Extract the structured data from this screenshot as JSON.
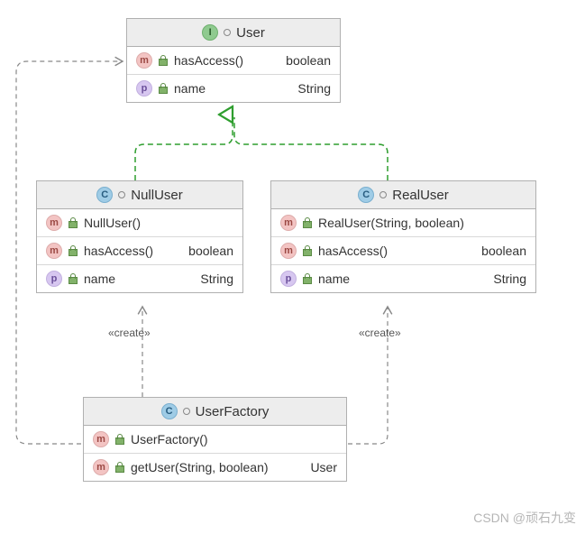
{
  "watermark": "CSDN @顽石九变",
  "stereotypes": {
    "create": "«create»"
  },
  "classes": {
    "user": {
      "kind": "I",
      "name": "User",
      "members": [
        {
          "icon": "m",
          "name": "hasAccess()",
          "type": "boolean"
        },
        {
          "icon": "p",
          "name": "name",
          "type": "String"
        }
      ]
    },
    "nullUser": {
      "kind": "C",
      "name": "NullUser",
      "members": [
        {
          "icon": "m",
          "name": "NullUser()",
          "type": ""
        },
        {
          "icon": "m",
          "name": "hasAccess()",
          "type": "boolean"
        },
        {
          "icon": "p",
          "name": "name",
          "type": "String"
        }
      ]
    },
    "realUser": {
      "kind": "C",
      "name": "RealUser",
      "members": [
        {
          "icon": "m",
          "name": "RealUser(String, boolean)",
          "type": ""
        },
        {
          "icon": "m",
          "name": "hasAccess()",
          "type": "boolean"
        },
        {
          "icon": "p",
          "name": "name",
          "type": "String"
        }
      ]
    },
    "userFactory": {
      "kind": "C",
      "name": "UserFactory",
      "members": [
        {
          "icon": "m",
          "name": "UserFactory()",
          "type": ""
        },
        {
          "icon": "m",
          "name": "getUser(String, boolean)",
          "type": "User"
        }
      ]
    }
  },
  "icon_letters": {
    "I": "I",
    "C": "C",
    "m": "m",
    "p": "p"
  }
}
